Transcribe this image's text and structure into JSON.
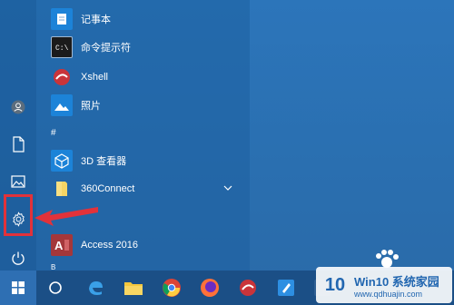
{
  "start_menu": {
    "apps": [
      {
        "label": "记事本",
        "icon": "notepad-icon"
      },
      {
        "label": "命令提示符",
        "icon": "cmd-icon"
      },
      {
        "label": "Xshell",
        "icon": "xshell-icon"
      },
      {
        "label": "照片",
        "icon": "photos-icon"
      },
      {
        "label": "3D 查看器",
        "icon": "3d-viewer-icon"
      },
      {
        "label": "360Connect",
        "icon": "folder-icon"
      },
      {
        "label": "Access 2016",
        "icon": "access-icon"
      }
    ],
    "section_letters": [
      "#",
      "B"
    ]
  },
  "taskbar": {
    "icons": [
      "windows-icon",
      "cortana-icon",
      "edge-icon",
      "file-explorer-icon",
      "chrome-icon",
      "firefox-icon",
      "xshell-icon",
      "notes-icon",
      "app-icon"
    ]
  },
  "watermark": {
    "logo": "10",
    "title": "Win10 系统家园",
    "url": "www.qdhuajin.com"
  },
  "colors": {
    "desktop": "#2a6fb1",
    "highlight": "#e2323a",
    "taskbar": "#1b4f86"
  }
}
